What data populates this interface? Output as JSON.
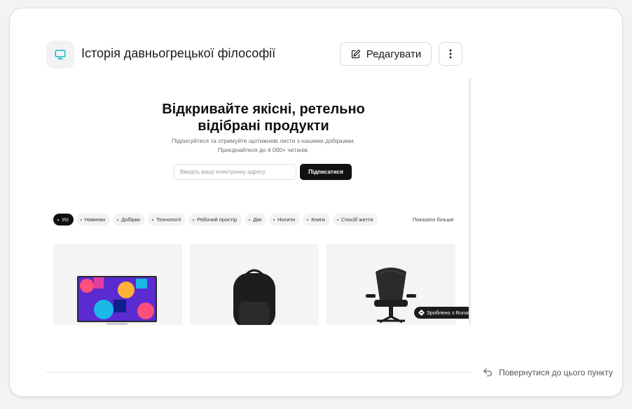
{
  "header": {
    "icon": "monitor-icon",
    "title": "Історія давньогрецької філософії",
    "edit_label": "Редагувати",
    "edit_icon": "pencil-icon",
    "more_icon": "more-vertical-icon"
  },
  "preview": {
    "hero_title": "Відкривайте якісні, ретельно відібрані продукти",
    "hero_subtitle_line1": "Підписуйтеся та отримуйте щотижневі листи з нашими добірками.",
    "hero_subtitle_line2": "Приєднайтеся до 4 000+ читачів.",
    "email_placeholder": "Введіть вашу електронну адресу",
    "subscribe_label": "Підписатися",
    "filters": [
      "Усі",
      "Новинки",
      "Добірки",
      "Технології",
      "Робочий простір",
      "Дім",
      "Носити",
      "Книги",
      "Спосіб життя"
    ],
    "show_more": "Показати більше",
    "products": [
      "monitor-image",
      "backpack-image",
      "office-chair-image"
    ],
    "badge_label": "Зроблено з Runable",
    "accent_color": "#1ab8c4"
  },
  "footer": {
    "back_label": "Повернутися до цього пункту",
    "back_icon": "undo-arrow-icon"
  }
}
